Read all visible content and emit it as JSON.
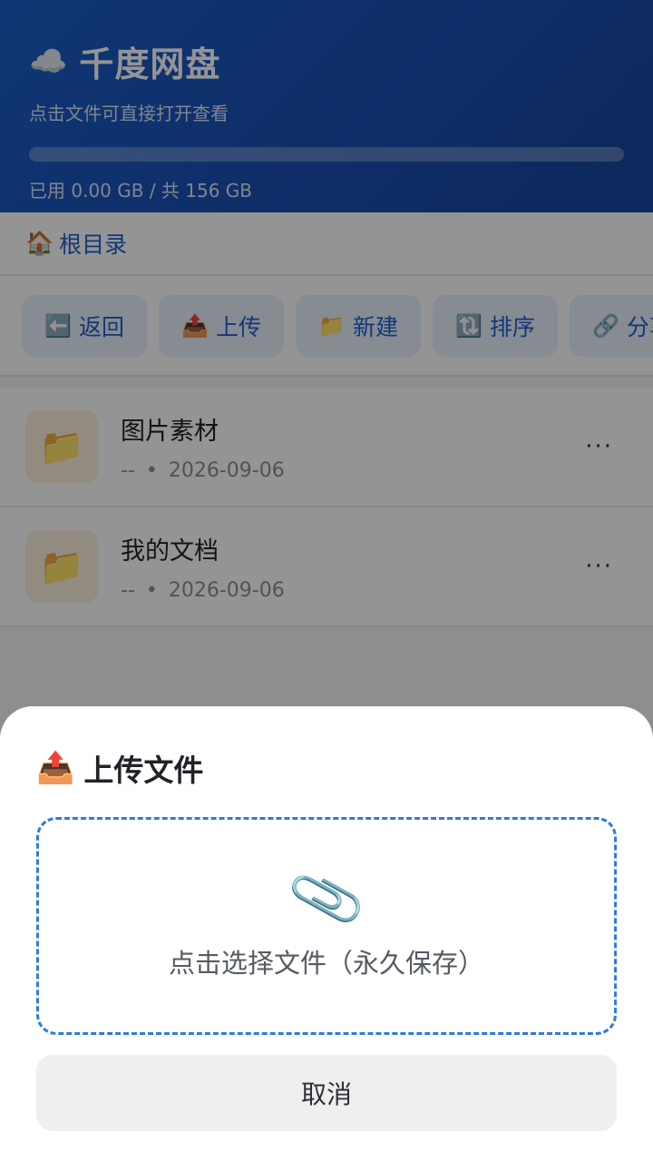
{
  "header": {
    "cloud_icon": "☁️",
    "title": "千度网盘",
    "subtitle": "点击文件可直接打开查看",
    "storage_used_fraction": 0.0,
    "storage_text": "已用 0.00 GB / 共 156 GB"
  },
  "breadcrumb": {
    "home_icon": "🏠",
    "label": "根目录"
  },
  "toolbar": {
    "buttons": [
      {
        "icon": "⬅️",
        "label": "返回"
      },
      {
        "icon": "📤",
        "label": "上传"
      },
      {
        "icon": "📁",
        "label": "新建"
      },
      {
        "icon": "🔃",
        "label": "排序"
      },
      {
        "icon": "🔗",
        "label": "分享"
      }
    ]
  },
  "files": [
    {
      "icon": "📁",
      "name": "图片素材",
      "size": "--",
      "sep": "•",
      "date": "2026-09-06",
      "more": "···"
    },
    {
      "icon": "📁",
      "name": "我的文档",
      "size": "--",
      "sep": "•",
      "date": "2026-09-06",
      "more": "···"
    }
  ],
  "upload_sheet": {
    "title_icon": "📤",
    "title": "上传文件",
    "clip_icon": "📎",
    "dropzone_text": "点击选择文件（永久保存）",
    "cancel_label": "取消"
  },
  "colors": {
    "header_gradient_start": "#1b5fc9",
    "header_gradient_end": "#17469e",
    "accent": "#1f5fcf",
    "dropzone_border": "#2f7ae0"
  }
}
